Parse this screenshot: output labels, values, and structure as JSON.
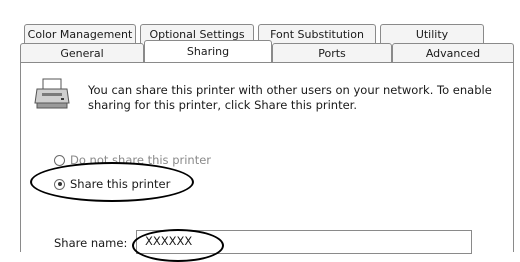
{
  "tabs_top": [
    {
      "label": "Color Management"
    },
    {
      "label": "Optional Settings"
    },
    {
      "label": "Font Substitution"
    },
    {
      "label": "Utility"
    }
  ],
  "tabs_bottom": [
    {
      "label": "General"
    },
    {
      "label": "Sharing",
      "active": true
    },
    {
      "label": "Ports"
    },
    {
      "label": "Advanced"
    }
  ],
  "description": "You can share this printer with other users on your network. To enable sharing for this printer, click Share this printer.",
  "radio_options": [
    {
      "label": "Do not share this printer",
      "checked": false
    },
    {
      "label": "Share this printer",
      "checked": true
    }
  ],
  "share_name": {
    "label": "Share name:",
    "value": "XXXXXX"
  },
  "icon": "printer-icon"
}
